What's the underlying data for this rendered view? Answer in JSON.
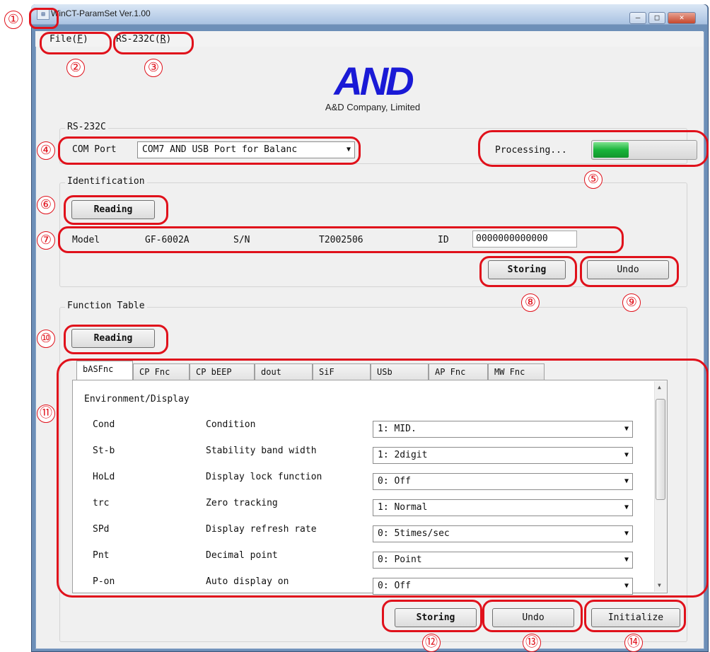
{
  "window": {
    "title": "WinCT-ParamSet Ver.1.00",
    "app_icon": "app-icon",
    "minimize": "–",
    "maximize": "□",
    "close": "✕"
  },
  "menu": {
    "file": "File(F)",
    "file_key": "F",
    "rs232c": "RS-232C(R)",
    "rs232c_key": "R"
  },
  "logo": {
    "mark": "AND",
    "company": "A&D Company, Limited"
  },
  "rs232c": {
    "group_label": "RS-232C",
    "com_port_label": "COM Port",
    "com_port_value": "COM7  AND USB Port for Balanc",
    "processing_text": "Processing...",
    "progress": 0.35
  },
  "identification": {
    "group_label": "Identification",
    "reading_button": "Reading",
    "model_label": "Model",
    "model_value": "GF-6002A",
    "sn_label": "S/N",
    "sn_value": "T2002506",
    "id_label": "ID",
    "id_value": "0000000000000",
    "storing_button": "Storing",
    "undo_button": "Undo"
  },
  "function_table": {
    "group_label": "Function Table",
    "reading_button": "Reading",
    "tabs": [
      "bASFnc",
      "CP Fnc",
      "CP bEEP",
      "dout",
      "SiF",
      "USb",
      "AP Fnc",
      "MW Fnc"
    ],
    "section_title": "Environment/Display",
    "rows": [
      {
        "code": "Cond",
        "desc": "Condition",
        "value": "1: MID."
      },
      {
        "code": "St-b",
        "desc": "Stability band width",
        "value": "1: 2digit"
      },
      {
        "code": "HoLd",
        "desc": "Display lock function",
        "value": "0: Off"
      },
      {
        "code": "trc",
        "desc": "Zero tracking",
        "value": "1: Normal"
      },
      {
        "code": "SPd",
        "desc": "Display refresh rate",
        "value": "0: 5times/sec"
      },
      {
        "code": "Pnt",
        "desc": "Decimal point",
        "value": "0: Point"
      },
      {
        "code": "P-on",
        "desc": "Auto display on",
        "value": "0: Off"
      }
    ],
    "storing_button": "Storing",
    "undo_button": "Undo",
    "initialize_button": "Initialize"
  },
  "annotations": [
    "①",
    "②",
    "③",
    "④",
    "⑤",
    "⑥",
    "⑦",
    "⑧",
    "⑨",
    "⑩",
    "⑪",
    "⑫",
    "⑬",
    "⑭"
  ],
  "colors": {
    "annotation_red": "#e0111b",
    "progress_green": "#19b43a",
    "logo_blue": "#1a1ad6"
  }
}
